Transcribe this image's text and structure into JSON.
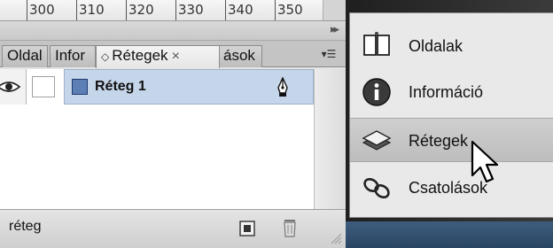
{
  "ruler": {
    "labels": [
      "300",
      "310",
      "320",
      "330",
      "340",
      "350"
    ]
  },
  "tabs": [
    {
      "label": "Oldal"
    },
    {
      "label": "Infor"
    },
    {
      "label": "Rétegek"
    },
    {
      "label": "ások"
    }
  ],
  "layer": {
    "name": "Réteg 1",
    "color": "#5c7fb6"
  },
  "footer": {
    "text": "réteg"
  },
  "dock": {
    "items": [
      {
        "label": "Oldalak",
        "icon": "pages-icon"
      },
      {
        "label": "Információ",
        "icon": "info-icon"
      },
      {
        "label": "Rétegek",
        "icon": "layers-icon",
        "selected": true
      },
      {
        "label": "Csatolások",
        "icon": "links-icon"
      }
    ]
  },
  "colors": {
    "selection": "#c6d6ea",
    "accent": "#5c7fb6"
  }
}
